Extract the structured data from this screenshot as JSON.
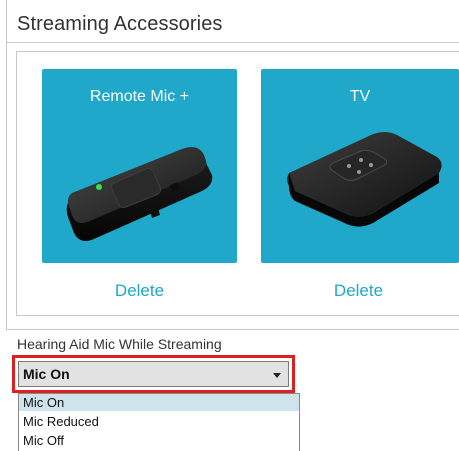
{
  "header": {
    "title": "Streaming Accessories"
  },
  "accessories": [
    {
      "label": "Remote Mic +",
      "delete_label": "Delete"
    },
    {
      "label": "TV",
      "delete_label": "Delete"
    }
  ],
  "mic_setting": {
    "label": "Hearing Aid Mic While Streaming",
    "selected": "Mic On",
    "options": [
      "Mic On",
      "Mic Reduced",
      "Mic Off"
    ]
  },
  "colors": {
    "card": "#1fa8c9",
    "link": "#1fa8c9",
    "highlight": "#e0201f",
    "selected_option": "#cfe3ec"
  }
}
